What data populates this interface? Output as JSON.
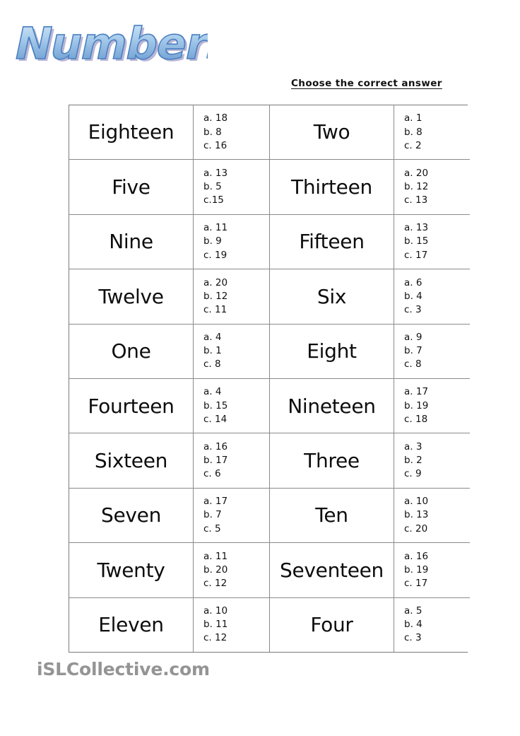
{
  "title": {
    "text": "Numbers",
    "fill_top": "#cfe4f6",
    "fill_bottom": "#5b8fc9",
    "outline": "#4a7fc1",
    "shadow": "#b9b6d6"
  },
  "instruction": "Choose the correct answer",
  "footer": {
    "watermark": "iSLCollective.com",
    "color": "#949494"
  },
  "worksheet": {
    "border_color": "#8a8a8a",
    "rows": [
      {
        "left": {
          "word": "Eighteen",
          "options": [
            "a. 18",
            "b. 8",
            "c. 16"
          ]
        },
        "right": {
          "word": "Two",
          "options": [
            "a. 1",
            "b. 8",
            "c. 2"
          ]
        }
      },
      {
        "left": {
          "word": "Five",
          "options": [
            "a. 13",
            "b. 5",
            "c.15"
          ]
        },
        "right": {
          "word": "Thirteen",
          "options": [
            "a. 20",
            "b. 12",
            "c. 13"
          ]
        }
      },
      {
        "left": {
          "word": "Nine",
          "options": [
            "a. 11",
            "b. 9",
            "c. 19"
          ]
        },
        "right": {
          "word": "Fifteen",
          "options": [
            "a. 13",
            "b. 15",
            "c. 17"
          ]
        }
      },
      {
        "left": {
          "word": "Twelve",
          "options": [
            "a. 20",
            "b. 12",
            "c. 11"
          ]
        },
        "right": {
          "word": "Six",
          "options": [
            "a. 6",
            "b. 4",
            "c. 3"
          ]
        }
      },
      {
        "left": {
          "word": "One",
          "options": [
            "a. 4",
            "b. 1",
            "c. 8"
          ]
        },
        "right": {
          "word": "Eight",
          "options": [
            "a. 9",
            "b. 7",
            "c. 8"
          ]
        }
      },
      {
        "left": {
          "word": "Fourteen",
          "options": [
            "a. 4",
            "b. 15",
            "c. 14"
          ]
        },
        "right": {
          "word": "Nineteen",
          "options": [
            "a. 17",
            "b. 19",
            "c. 18"
          ]
        }
      },
      {
        "left": {
          "word": "Sixteen",
          "options": [
            "a. 16",
            "b. 17",
            "c. 6"
          ]
        },
        "right": {
          "word": "Three",
          "options": [
            "a. 3",
            "b. 2",
            "c. 9"
          ]
        }
      },
      {
        "left": {
          "word": "Seven",
          "options": [
            "a. 17",
            "b. 7",
            "c. 5"
          ]
        },
        "right": {
          "word": "Ten",
          "options": [
            "a. 10",
            "b. 13",
            "c. 20"
          ]
        }
      },
      {
        "left": {
          "word": "Twenty",
          "options": [
            "a. 11",
            "b. 20",
            "c. 12"
          ]
        },
        "right": {
          "word": "Seventeen",
          "options": [
            "a. 16",
            "b. 19",
            "c. 17"
          ]
        }
      },
      {
        "left": {
          "word": "Eleven",
          "options": [
            "a. 10",
            "b. 11",
            "c. 12"
          ]
        },
        "right": {
          "word": "Four",
          "options": [
            "a. 5",
            "b. 4",
            "c. 3"
          ]
        }
      }
    ]
  }
}
